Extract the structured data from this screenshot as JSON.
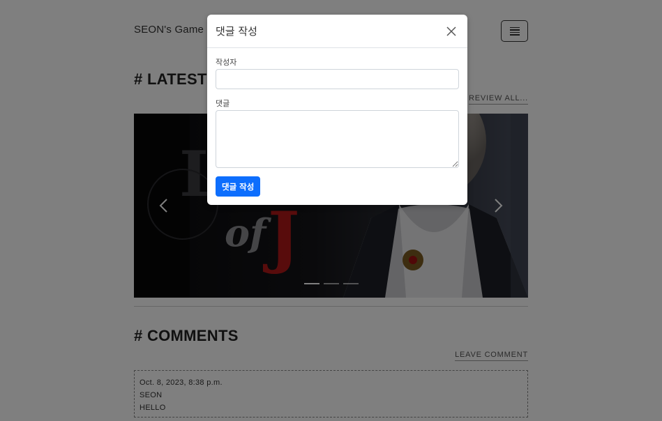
{
  "header": {
    "brand": "SEON's Game Review"
  },
  "sections": {
    "latest": {
      "title": "# LATEST",
      "link": "REVIEW ALL..."
    },
    "comments": {
      "title": "# COMMENTS",
      "link": "LEAVE COMMENT"
    }
  },
  "carousel": {
    "slide_count": 3,
    "active_index": 0,
    "logo_text": "LIES of P"
  },
  "comment": {
    "date": "Oct. 8, 2023, 8:38 p.m.",
    "author": "SEON",
    "text": "HELLO"
  },
  "modal": {
    "title": "댓글 작성",
    "author_label": "작성자",
    "author_value": "",
    "comment_label": "댓글",
    "comment_value": "",
    "submit_label": "댓글 작성"
  },
  "colors": {
    "primary": "#0d6efd",
    "backdrop": "rgba(0,0,0,0.5)"
  },
  "icons": {
    "close": "close-icon",
    "menu": "hamburger-icon",
    "prev": "chevron-left-icon",
    "next": "chevron-right-icon"
  }
}
